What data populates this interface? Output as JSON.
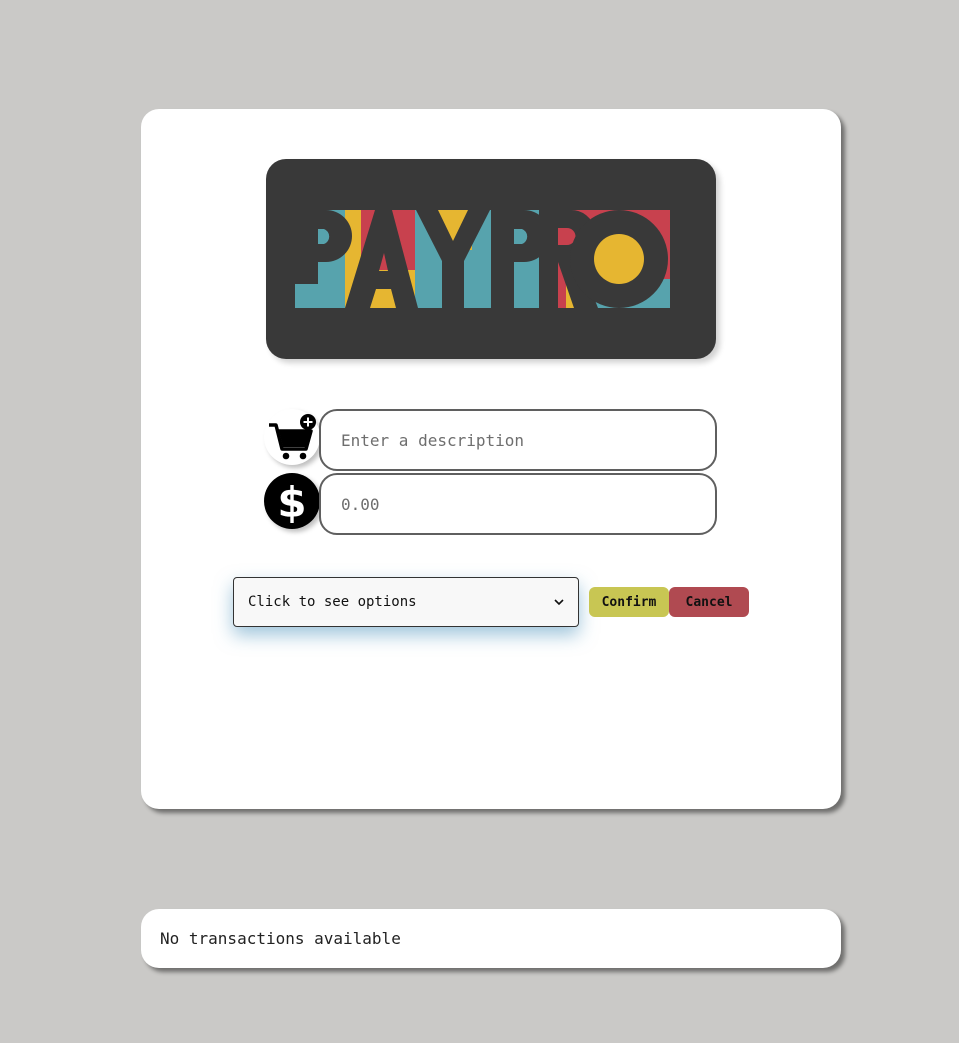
{
  "logo": {
    "text": "PAYPRO",
    "colors": {
      "background": "#393939",
      "teal": "#57a3ad",
      "yellow": "#e6b631",
      "red": "#c8414e",
      "dark": "#393939"
    }
  },
  "form": {
    "description_icon": "cart-plus-icon",
    "amount_icon": "dollar-icon",
    "description_placeholder": "Enter a description",
    "amount_placeholder": "0.00",
    "select_label": "Click to see options",
    "confirm_label": "Confirm",
    "cancel_label": "Cancel",
    "colors": {
      "confirm": "#c8c653",
      "cancel": "#b04a51"
    }
  },
  "transactions": {
    "empty_message": "No transactions available"
  },
  "page": {
    "background": "#cac9c7"
  }
}
